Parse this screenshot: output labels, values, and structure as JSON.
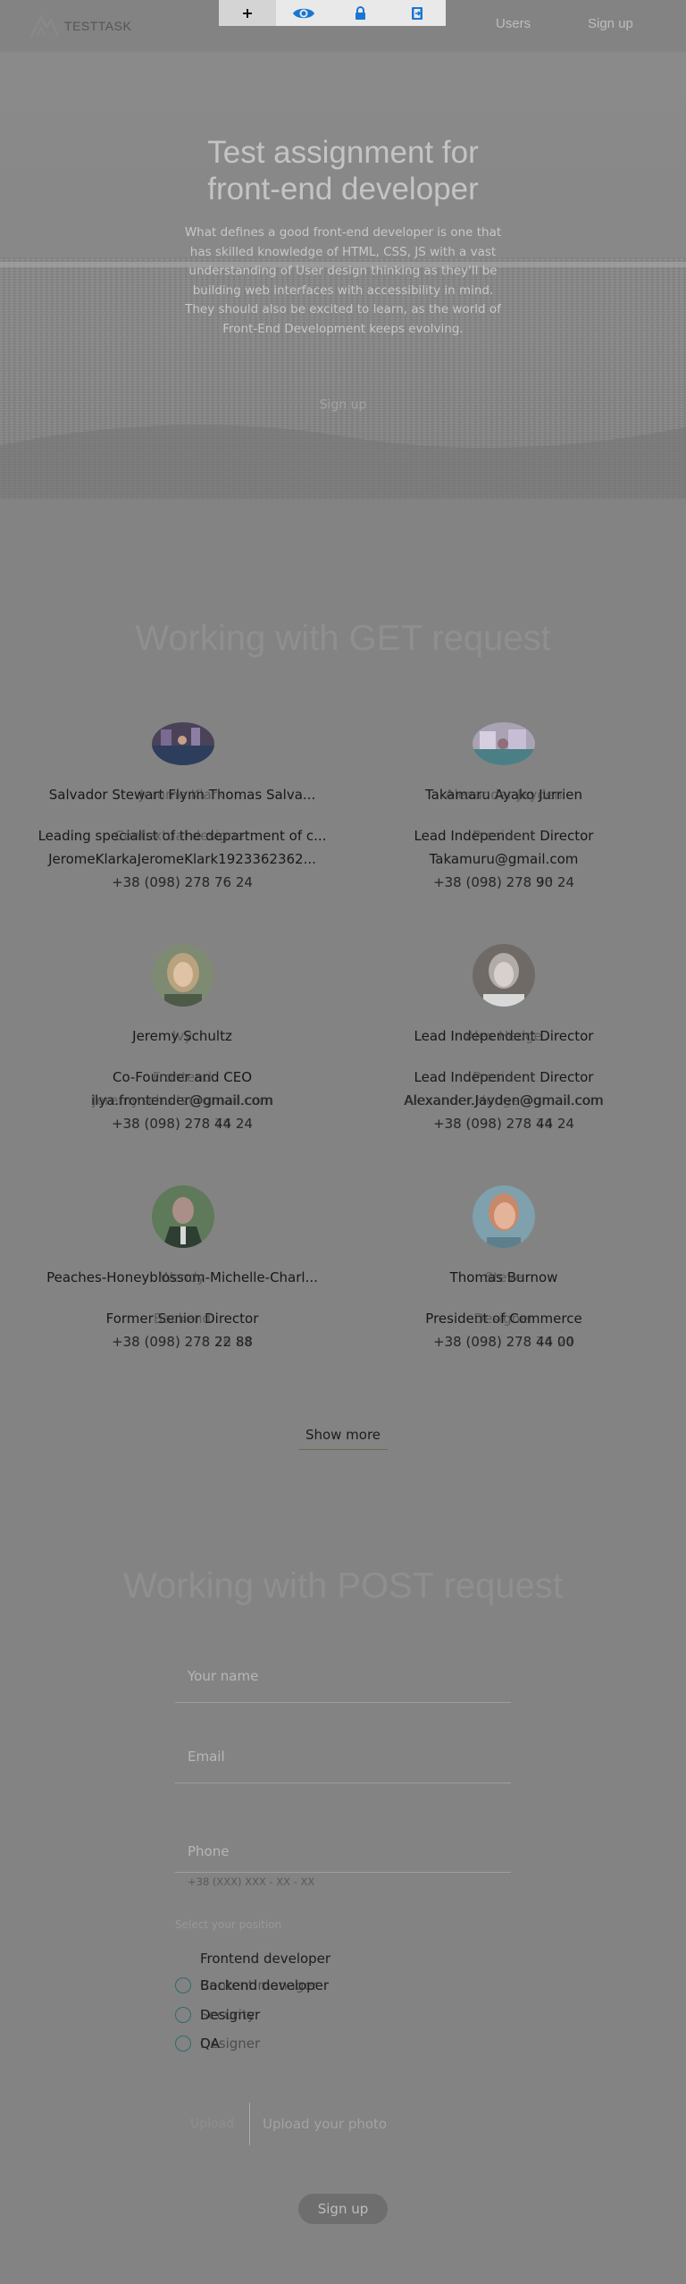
{
  "header": {
    "logo_text": "TESTTASK",
    "nav": {
      "users": "Users",
      "signup": "Sign up"
    },
    "toolbar": [
      "plus-icon",
      "eye-icon",
      "lock-icon",
      "exit-icon"
    ]
  },
  "hero": {
    "title_line1": "Test assignment for",
    "title_line2": "front-end developer",
    "text_lines": [
      "What defines a good front-end developer is one that",
      "has skilled knowledge of HTML, CSS, JS with a vast",
      "understanding of User design thinking as they'll be",
      "building web interfaces with accessibility in mind.",
      "They should also be excited to learn, as the world of",
      "Front-End Development keeps evolving."
    ],
    "signup_label": "Sign up"
  },
  "get_section": {
    "title": "Working with GET request",
    "show_more_label": "Show more",
    "users": [
      {
        "name": "Salvador Stewart Flynn Thomas Salva...",
        "name_ghost": "Jerome Klark",
        "position": "Leading specialist of the department of c...",
        "position_ghost": "Contextual designer",
        "email": "JeromeKlarkaJeromeKlark1923362362...",
        "phone": "+38 (098) 278 76 24",
        "phone_ghost": "+38 (098) 278 76 24"
      },
      {
        "name": "Takamaru Ayako Jurrien",
        "name_ghost": "Alexander Jayden",
        "position": "Lead Independent Director",
        "position_ghost": "President",
        "email": "Takamuru@gmail.com",
        "phone": "+38 (098) 278 90 24",
        "phone_ghost": "+38 (098) 278 76 24"
      },
      {
        "name": "Jeremy Schultz",
        "name_ghost": "Ivy",
        "position": "Co-Founder and CEO",
        "position_ghost": "Frontend",
        "email": "ilya.frontender@gmail.com",
        "email_ghost": "Jeremy.schultz@gmail.com",
        "phone": "+38 (098) 278 44 24",
        "phone_ghost": "+38 (098) 278 76 24"
      },
      {
        "name": "Lead Independent Director",
        "name_ghost": "Alex Hedge",
        "position": "Lead Independent Director",
        "position_ghost": "President",
        "email": "Alexander.Jayden@gmail.com",
        "email_ghost": "Alexander.Hedge@gmail.com",
        "phone": "+38 (098) 278 44 24",
        "phone_ghost": "+38 (098) 278 76 24"
      },
      {
        "name": "Peaches-Honeyblossom-Michelle-Charl...",
        "name_ghost": "Wendy",
        "position": "Former Senior Director",
        "position_ghost": "Backend",
        "phone": "+38 (098) 278 22 88",
        "phone_ghost": "+38 (098) 278 76 24"
      },
      {
        "name": "Thomas Burnow",
        "name_ghost": "Steve",
        "position": "President of Commerce",
        "position_ghost": "Designer",
        "phone": "+38 (098) 278 44 00",
        "phone_ghost": "+38 (098) 278 76 24"
      }
    ]
  },
  "post_section": {
    "title": "Working with POST request",
    "name_placeholder": "Your name",
    "email_placeholder": "Email",
    "phone_placeholder": "Phone",
    "phone_helper": "+38 (XXX) XXX - XX - XX",
    "position_title": "Select your position",
    "positions": [
      "Frontend developer",
      "Backend developer",
      "Designer",
      "QA"
    ],
    "positions_ghost": [
      "Content manager",
      "Security",
      "Designer"
    ],
    "upload_button": "Upload",
    "upload_placeholder": "Upload your photo",
    "submit_label": "Sign up"
  },
  "colors": {
    "background": "#838383",
    "radio_border": "#2f6b6b",
    "toolbar_icon": "#1976d2"
  }
}
